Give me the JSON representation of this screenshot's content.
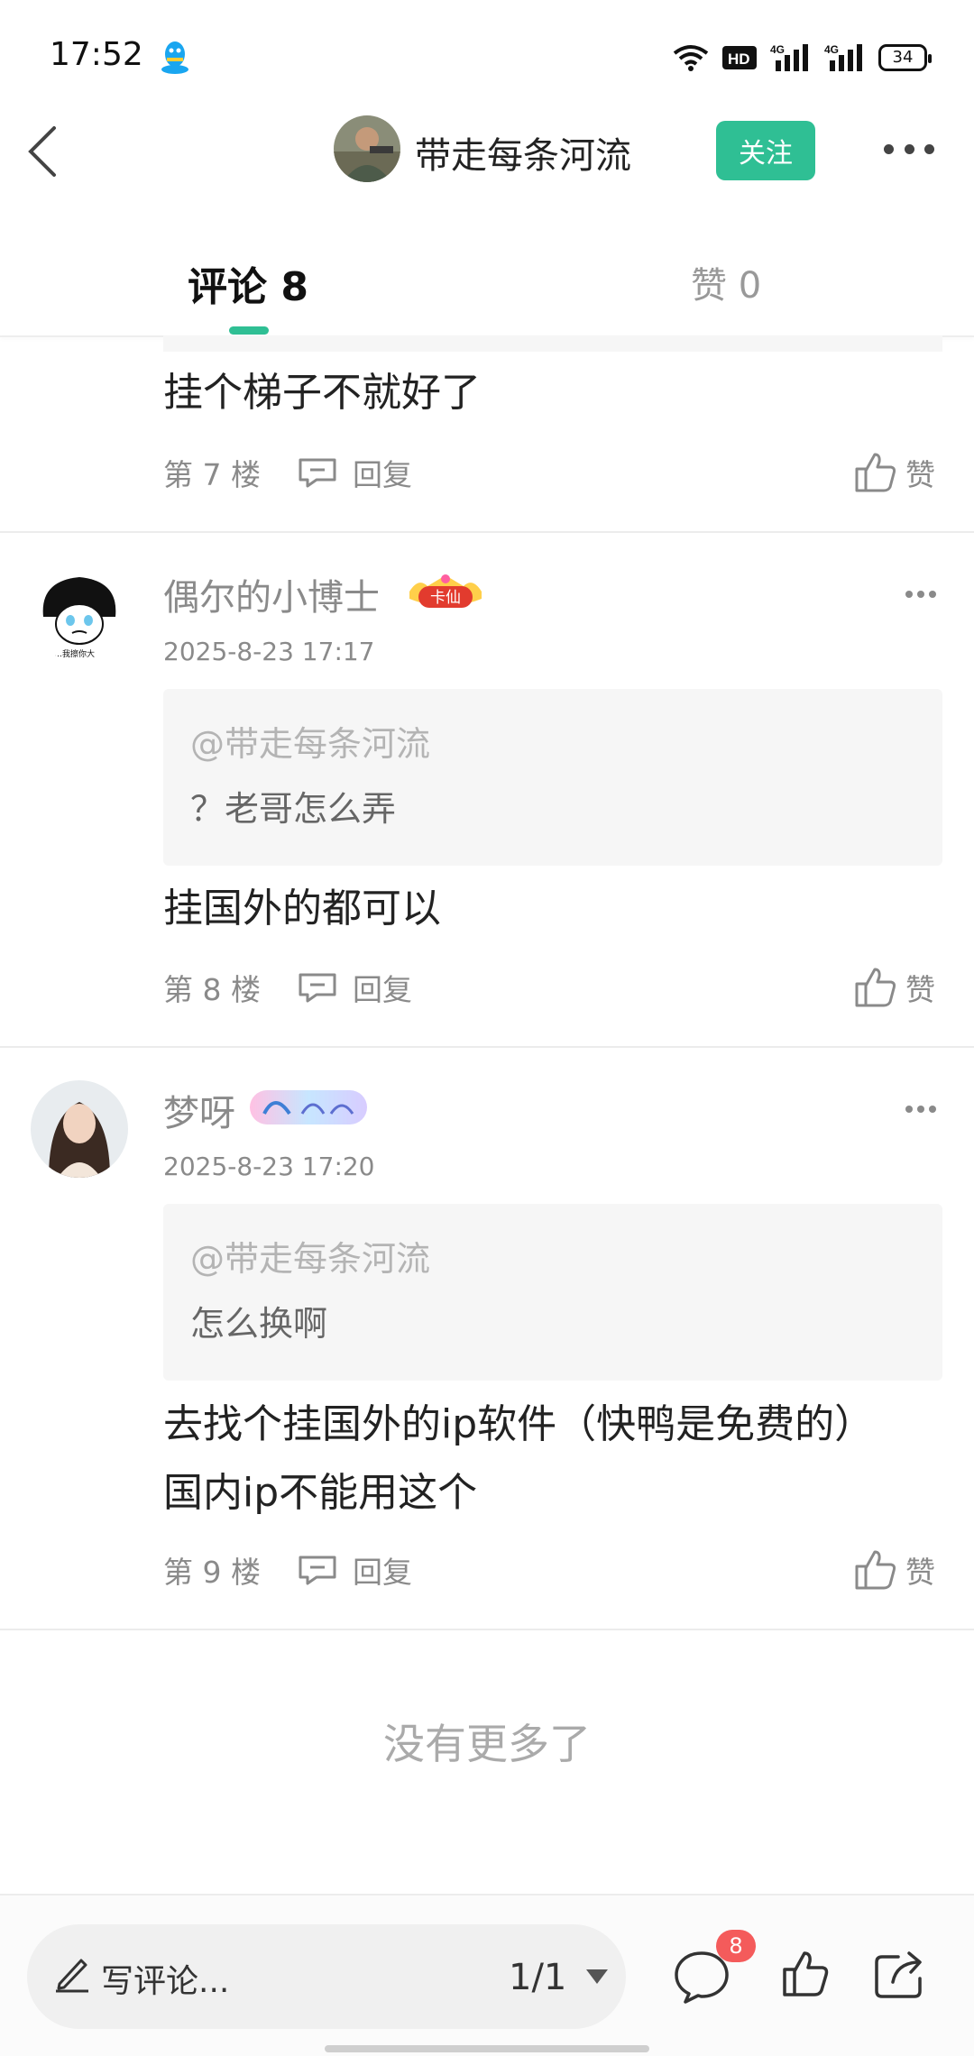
{
  "status_bar": {
    "time": "17:52",
    "network_1": "4G",
    "network_2": "4G",
    "battery": "34",
    "icons": [
      "qq-icon",
      "wifi-icon",
      "hd-icon",
      "signal-icon",
      "battery-icon"
    ]
  },
  "header": {
    "title": "带走每条河流",
    "follow_label": "关注"
  },
  "tabs": {
    "comments_label": "评论 8",
    "likes_label": "赞 0"
  },
  "comments": [
    {
      "text": "挂个梯子不就好了",
      "floor": "第 7 楼",
      "reply_label": "回复",
      "like_label": "赞"
    },
    {
      "username": "偶尔的小博士",
      "badge": "卡仙",
      "timestamp": "2025-8-23 17:17",
      "quote_mention": "@带走每条河流",
      "quote_text": "？老哥怎么弄",
      "text": "挂国外的都可以",
      "floor": "第 8 楼",
      "reply_label": "回复",
      "like_label": "赞"
    },
    {
      "username": "梦呀",
      "timestamp": "2025-8-23 17:20",
      "quote_mention": "@带走每条河流",
      "quote_text": "怎么换啊",
      "text_line1": "去找个挂国外的ip软件（快鸭是免费的）",
      "text_line2": "国内ip不能用这个",
      "floor": "第 9 楼",
      "reply_label": "回复",
      "like_label": "赞"
    }
  ],
  "footer_message": "没有更多了",
  "bottom_bar": {
    "write_placeholder": "写评论...",
    "page_indicator": "1/1",
    "comment_count": "8"
  },
  "colors": {
    "accent": "#2fbf94",
    "badge_red": "#f45b5b",
    "muted_text": "#8a8a8a"
  }
}
